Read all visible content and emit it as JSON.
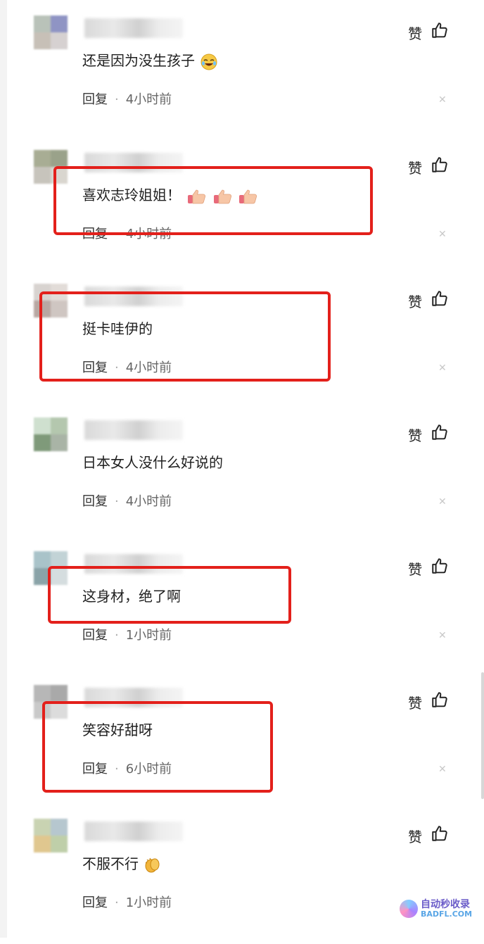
{
  "like_label": "赞",
  "reply_label": "回复",
  "comments": [
    {
      "text": "还是因为没生孩子",
      "emoji": "laughing-crying-emoji",
      "time": "4小时前",
      "avatar": [
        "#b9c2b9",
        "#8f94c4",
        "#c7c0b7",
        "#d6d1d1"
      ]
    },
    {
      "text": "喜欢志玲姐姐！",
      "emoji": "thumbs-up-emoji-x3",
      "time": "4小时前",
      "avatar": [
        "#a8ad94",
        "#9aa28a",
        "#c7c4bc",
        "#d9d6cf"
      ]
    },
    {
      "text": "挺卡哇伊的",
      "emoji": "",
      "time": "4小时前",
      "avatar": [
        "#d8d3d0",
        "#e2dcd8",
        "#b8a7a2",
        "#cfc6c2"
      ]
    },
    {
      "text": "日本女人没什么好说的",
      "emoji": "",
      "time": "4小时前",
      "avatar": [
        "#cfe0cf",
        "#b4c7ae",
        "#7f9a7a",
        "#a9b4a6"
      ]
    },
    {
      "text": "这身材，绝了啊",
      "emoji": "",
      "time": "1小时前",
      "avatar": [
        "#a9c3c9",
        "#c2d3d6",
        "#8aa3a8",
        "#d5dddf"
      ]
    },
    {
      "text": "笑容好甜呀",
      "emoji": "",
      "time": "6小时前",
      "avatar": [
        "#b7b7b7",
        "#a9a9a9",
        "#c9c9c9",
        "#dcdcdc"
      ]
    },
    {
      "text": "不服不行",
      "emoji": "clapping-hands-emoji",
      "time": "1小时前",
      "avatar": [
        "#c9d3b2",
        "#b6c7cf",
        "#e0c78f",
        "#bfcfa9"
      ]
    }
  ],
  "highlight_color": "#e3201b",
  "watermark": {
    "line1": "自动秒收录",
    "line2": "BADFL.COM"
  }
}
